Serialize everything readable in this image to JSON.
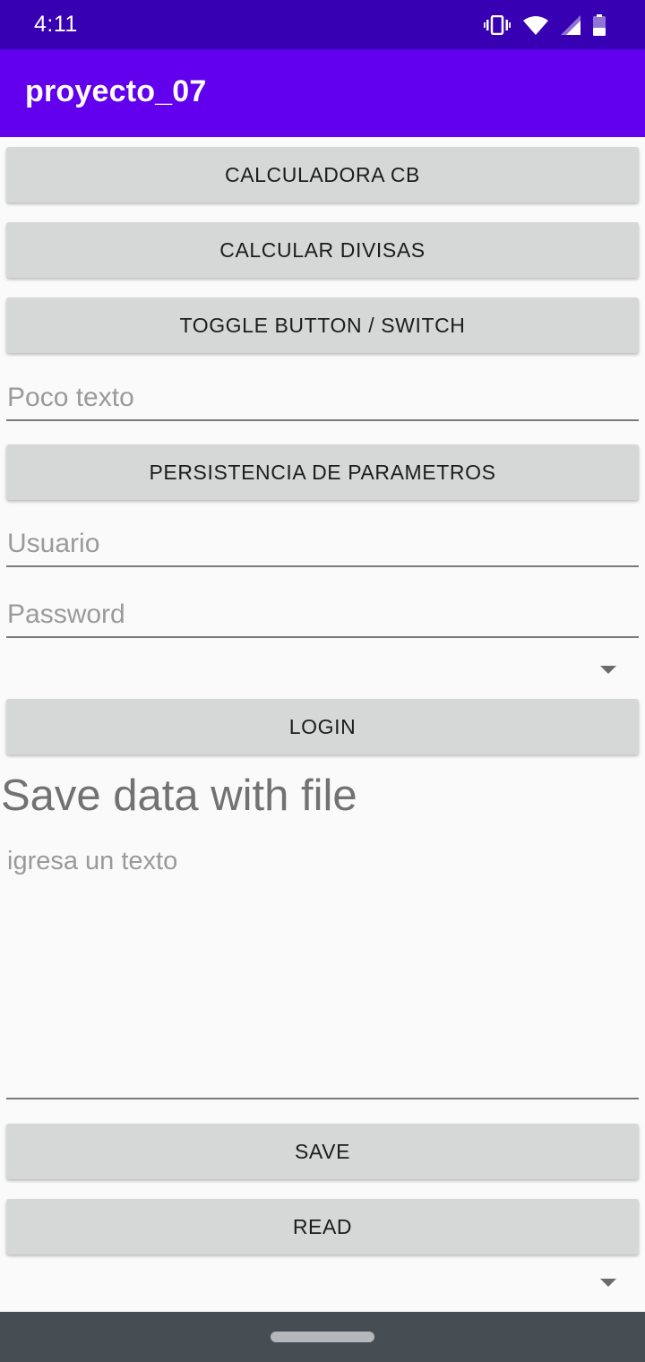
{
  "status_bar": {
    "time": "4:11",
    "icons": [
      "vibrate-icon",
      "wifi-icon",
      "signal-icon",
      "battery-icon"
    ]
  },
  "app_bar": {
    "title": "proyecto_07"
  },
  "buttons": {
    "calculadora": "CALCULADORA CB",
    "divisas": "CALCULAR DIVISAS",
    "toggle": "TOGGLE BUTTON / SWITCH",
    "persistencia": "PERSISTENCIA DE PARAMETROS",
    "login": "LOGIN",
    "save": "SAVE",
    "read": "READ"
  },
  "fields": {
    "poco_texto": {
      "value": "",
      "placeholder": "Poco texto"
    },
    "usuario": {
      "value": "",
      "placeholder": "Usuario"
    },
    "password": {
      "value": "",
      "placeholder": "Password"
    },
    "texto": {
      "value": "",
      "placeholder": "igresa un texto"
    }
  },
  "spinners": {
    "first": {
      "selected": ""
    },
    "second": {
      "selected": ""
    }
  },
  "section": {
    "title": "Save data with file"
  },
  "colors": {
    "status_bar": "#3700b3",
    "app_bar": "#6200ee",
    "button": "#d6d7d7",
    "background": "#fafafa"
  }
}
